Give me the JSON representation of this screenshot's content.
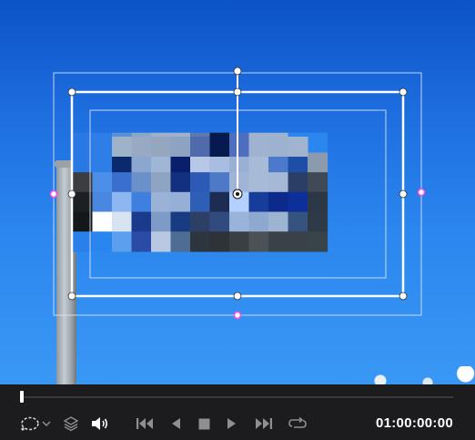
{
  "viewer": {
    "subject": "road-sign-on-pole",
    "effect_name_icon": "mosaic-blur",
    "colors": {
      "sky_top": "#0b53c7",
      "sky_bottom": "#3a98f5",
      "handle_accent": "#ff4fd8",
      "frame_line": "#ffffff"
    }
  },
  "transport": {
    "timecode": "01:00:00:00",
    "playhead_progress": 0.0,
    "icons": {
      "crop_tool": "dashed-circle-icon",
      "mode_chevron": "chevron-down-icon",
      "layers": "layers-icon",
      "volume": "speaker-icon",
      "prev": "skip-to-start-icon",
      "back": "play-reverse-icon",
      "stop": "stop-icon",
      "play": "play-icon",
      "next": "skip-to-end-icon",
      "loop": "loop-icon"
    }
  }
}
